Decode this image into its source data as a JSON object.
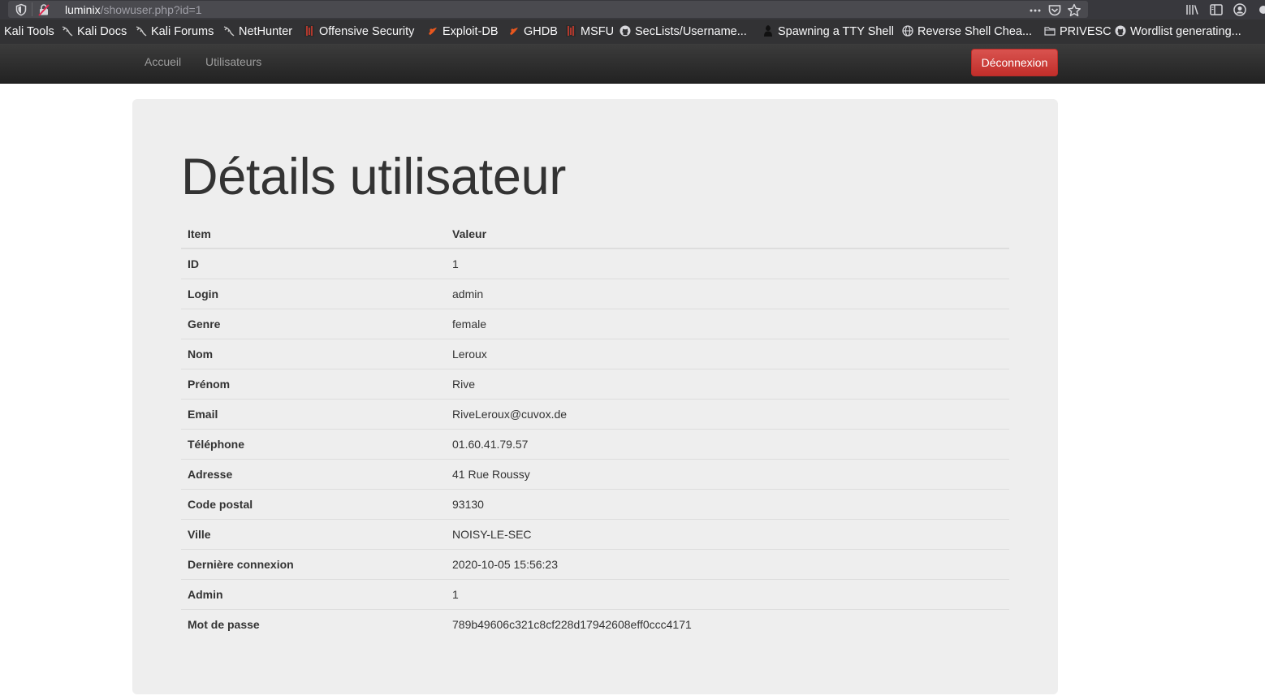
{
  "browser": {
    "url_host": "luminix",
    "url_path": "/showuser.php?id=1"
  },
  "bookmarks": [
    {
      "label": "Kali Tools",
      "icon": "kali-dragon-icon"
    },
    {
      "label": "Kali Docs",
      "icon": "kali-dragon-icon"
    },
    {
      "label": "Kali Forums",
      "icon": "kali-dragon-icon"
    },
    {
      "label": "NetHunter",
      "icon": "kali-dragon-icon"
    },
    {
      "label": "Offensive Security",
      "icon": "offsec-icon"
    },
    {
      "label": "Exploit-DB",
      "icon": "exploit-db-icon"
    },
    {
      "label": "GHDB",
      "icon": "exploit-db-icon"
    },
    {
      "label": "MSFU",
      "icon": "offsec-icon"
    },
    {
      "label": "SecLists/Username...",
      "icon": "github-icon"
    },
    {
      "label": "Spawning a TTY Shell",
      "icon": "hacker-icon"
    },
    {
      "label": "Reverse Shell Chea...",
      "icon": "globe-icon"
    },
    {
      "label": "PRIVESC",
      "icon": "folder-icon"
    },
    {
      "label": "Wordlist generating...",
      "icon": "github-icon"
    }
  ],
  "nav": {
    "home": "Accueil",
    "users": "Utilisateurs",
    "logout": "Déconnexion"
  },
  "page": {
    "title": "Détails utilisateur"
  },
  "table": {
    "headers": [
      "Item",
      "Valeur"
    ],
    "rows": [
      {
        "key": "ID",
        "value": "1"
      },
      {
        "key": "Login",
        "value": "admin"
      },
      {
        "key": "Genre",
        "value": "female"
      },
      {
        "key": "Nom",
        "value": "Leroux"
      },
      {
        "key": "Prénom",
        "value": "Rive"
      },
      {
        "key": "Email",
        "value": "RiveLeroux@cuvox.de"
      },
      {
        "key": "Téléphone",
        "value": "01.60.41.79.57"
      },
      {
        "key": "Adresse",
        "value": "41 Rue Roussy"
      },
      {
        "key": "Code postal",
        "value": "93130"
      },
      {
        "key": "Ville",
        "value": "NOISY-LE-SEC"
      },
      {
        "key": "Dernière connexion",
        "value": "2020-10-05 15:56:23"
      },
      {
        "key": "Admin",
        "value": "1"
      },
      {
        "key": "Mot de passe",
        "value": "789b49606c321c8cf228d17942608eff0ccc4171"
      }
    ]
  },
  "colors": {
    "danger": "#d9534f",
    "navbar": "#222222",
    "jumbotron": "#eeeeee"
  }
}
